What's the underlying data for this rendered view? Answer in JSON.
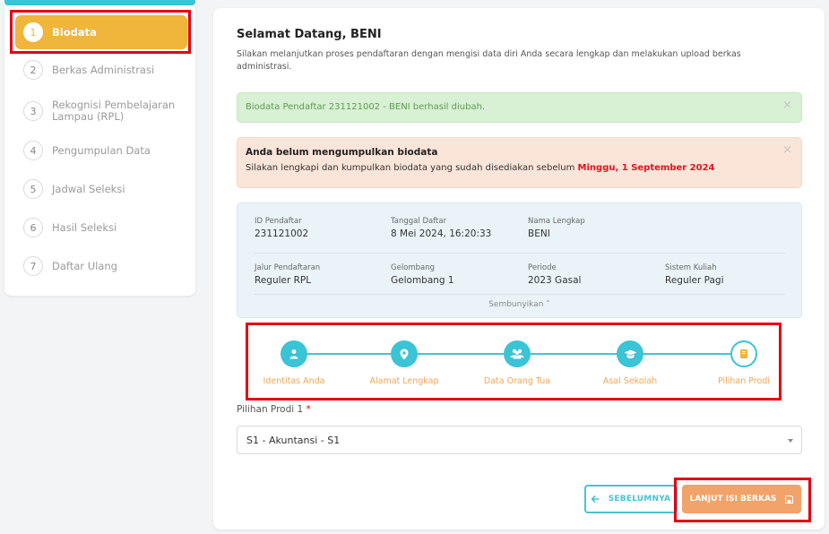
{
  "sidebar": {
    "items": [
      {
        "num": "1",
        "label": "Biodata"
      },
      {
        "num": "2",
        "label": "Berkas Administrasi"
      },
      {
        "num": "3",
        "label": "Rekognisi Pembelajaran Lampau (RPL)"
      },
      {
        "num": "4",
        "label": "Pengumpulan Data"
      },
      {
        "num": "5",
        "label": "Jadwal Seleksi"
      },
      {
        "num": "6",
        "label": "Hasil Seleksi"
      },
      {
        "num": "7",
        "label": "Daftar Ulang"
      }
    ]
  },
  "main": {
    "title": "Selamat Datang, BENI",
    "subtitle": "Silakan melanjutkan proses pendaftaran dengan mengisi data diri Anda secara lengkap dan melakukan upload berkas administrasi.",
    "alert_success": "Biodata Pendaftar 231121002 - BENI berhasil diubah.",
    "alert_warning": {
      "heading": "Anda belum mengumpulkan biodata",
      "message": "Silakan lengkapi dan kumpulkan biodata yang sudah disediakan sebelum",
      "deadline": "Minggu, 1 September 2024"
    },
    "close_glyph": "×",
    "info": {
      "id_label": "ID Pendaftar",
      "id_value": "231121002",
      "date_label": "Tanggal Daftar",
      "date_value": "8 Mei 2024, 16:20:33",
      "name_label": "Nama Lengkap",
      "name_value": "BENI",
      "path_label": "Jalur Pendaftaran",
      "path_value": "Reguler RPL",
      "wave_label": "Gelombang",
      "wave_value": "Gelombang 1",
      "period_label": "Periode",
      "period_value": "2023 Gasal",
      "system_label": "Sistem Kuliah",
      "system_value": "Reguler Pagi",
      "toggle_label": "Sembunyikan ˄"
    },
    "wizard": {
      "steps": [
        {
          "label": "Identitas Anda",
          "icon": "user-icon"
        },
        {
          "label": "Alamat Lengkap",
          "icon": "map-pin-icon"
        },
        {
          "label": "Data Orang Tua",
          "icon": "users-icon"
        },
        {
          "label": "Asal Sekolah",
          "icon": "graduation-cap-icon"
        },
        {
          "label": "Pilihan Prodi",
          "icon": "book-icon"
        }
      ]
    },
    "form": {
      "prodi_label": "Pilihan Prodi 1",
      "required_mark": "*",
      "prodi_value": "S1 - Akuntansi - S1"
    },
    "buttons": {
      "prev_label": "SEBELUMNYA",
      "next_label": "LANJUT ISI BERKAS"
    }
  },
  "colors": {
    "accent": "#3bc3d6",
    "active": "#f0b53b",
    "next_button": "#f2a36a",
    "highlight": "#e5000c"
  }
}
